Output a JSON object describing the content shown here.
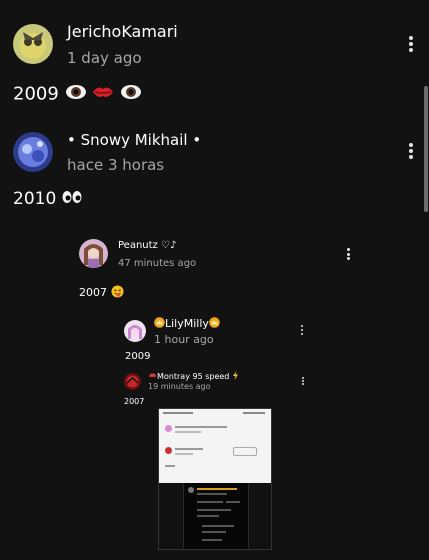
{
  "comments": [
    {
      "user": "JerichoKamari",
      "time": "1 day ago",
      "text": "2009",
      "emojis": [
        "eye-emoji",
        "lips-emoji",
        "eye-emoji"
      ]
    },
    {
      "user": "• Snowy Mikhail •",
      "time": "hace 3 horas",
      "text": "2010",
      "emojis": [
        "eyes-emoji"
      ]
    }
  ],
  "replies": [
    {
      "user": "Peanutz ♡♪",
      "time": "47 minutes ago",
      "text": "2007",
      "emojis": [
        "tongue-face-emoji"
      ]
    },
    {
      "user": "LilyMilly",
      "time": "1 hour ago",
      "text": "2009",
      "emojis": [
        "crown-emoji",
        "crown-emoji"
      ]
    },
    {
      "user": "Montray 95 speed",
      "time": "19 minutes ago",
      "text": "2007",
      "emojis": [
        "car-emoji",
        "lightning-emoji"
      ]
    }
  ],
  "attachment": {
    "type": "embedded-screenshot"
  },
  "colors": {
    "background": "#121212",
    "secondary_text": "#a6a6a6"
  }
}
